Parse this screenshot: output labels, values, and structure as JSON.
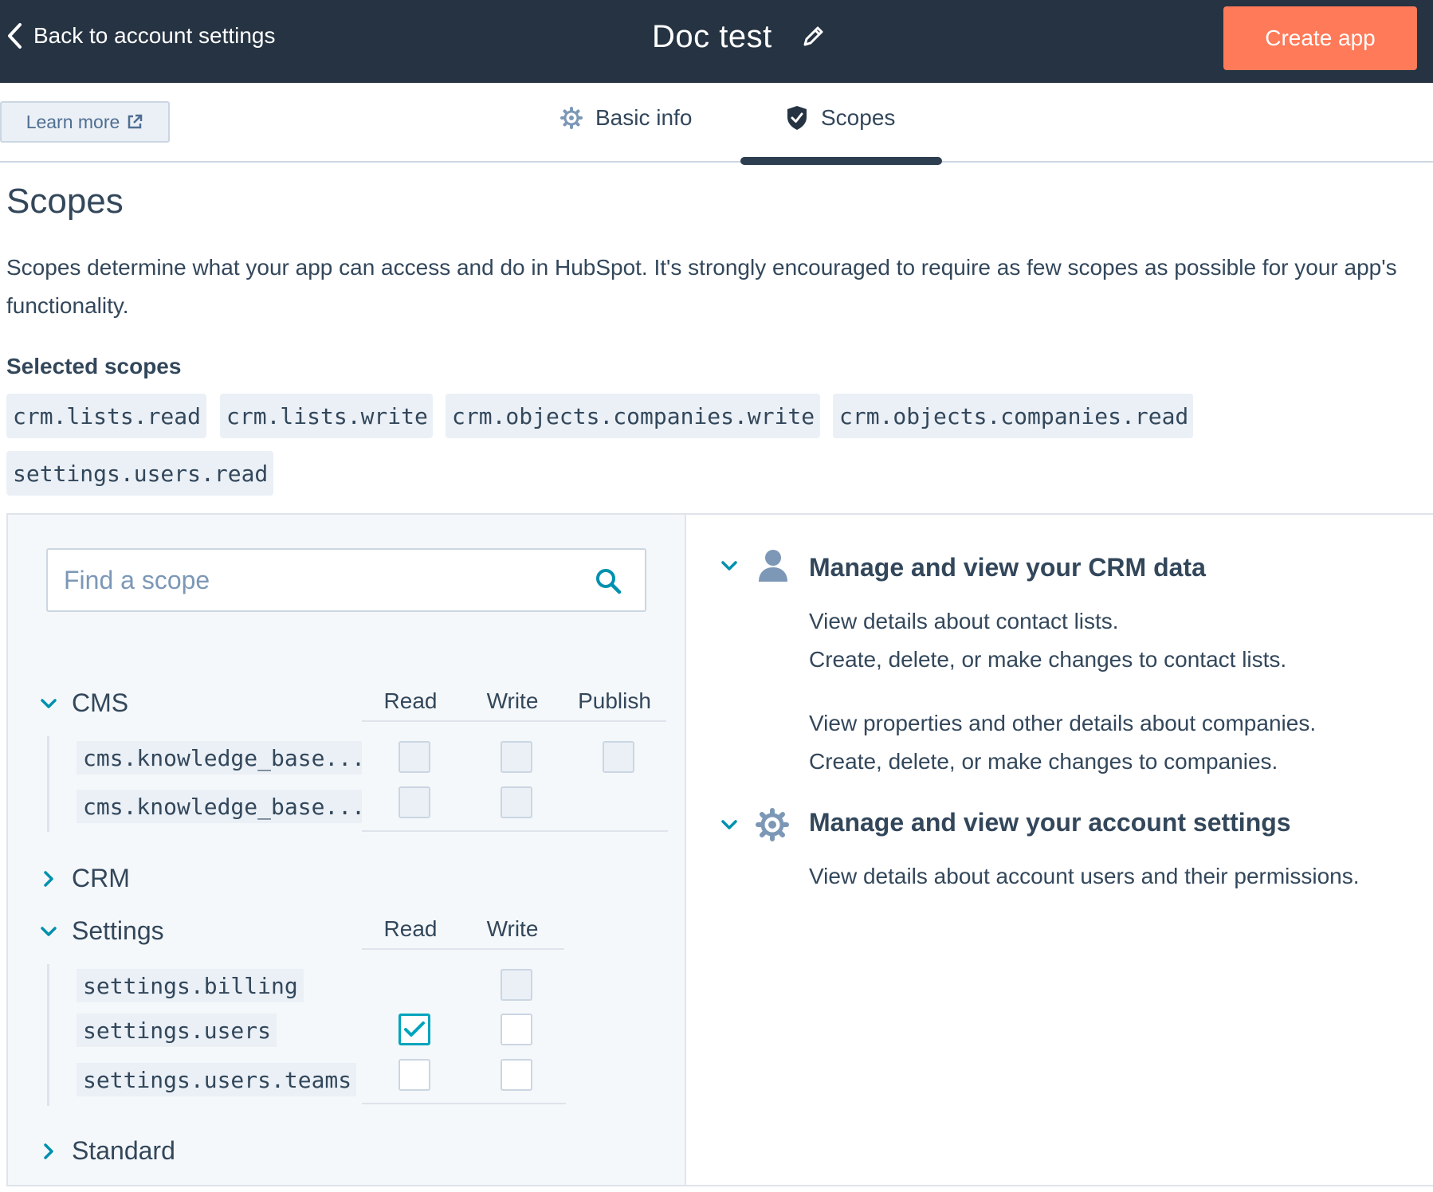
{
  "header": {
    "back_label": "Back to account settings",
    "app_title": "Doc test",
    "create_button": "Create app"
  },
  "toolbar": {
    "learn_more": "Learn more"
  },
  "tabs": [
    {
      "label": "Basic info",
      "icon": "gear-icon",
      "active": false
    },
    {
      "label": "Scopes",
      "icon": "shield-icon",
      "active": true
    }
  ],
  "page": {
    "heading": "Scopes",
    "description": "Scopes determine what your app can access and do in HubSpot. It's strongly encouraged to require as few scopes as possible for your app's functionality.",
    "selected_label": "Selected scopes",
    "selected_scopes": [
      "crm.lists.read",
      "crm.lists.write",
      "crm.objects.companies.write",
      "crm.objects.companies.read",
      "settings.users.read"
    ]
  },
  "search": {
    "placeholder": "Find a scope"
  },
  "scope_sections": {
    "cms": {
      "label": "CMS",
      "columns": [
        "Read",
        "Write",
        "Publish"
      ],
      "rows": [
        "cms.knowledge_base....",
        "cms.knowledge_base...."
      ]
    },
    "crm": {
      "label": "CRM"
    },
    "settings": {
      "label": "Settings",
      "columns": [
        "Read",
        "Write"
      ],
      "rows": [
        "settings.billing",
        "settings.users",
        "settings.users.teams"
      ]
    },
    "standard": {
      "label": "Standard"
    }
  },
  "permissions": {
    "crm": {
      "title": "Manage and view your CRM data",
      "lines": [
        "View details about contact lists.",
        "Create, delete, or make changes to contact lists.",
        "View properties and other details about companies.",
        "Create, delete, or make changes to companies."
      ]
    },
    "account": {
      "title": "Manage and view your account settings",
      "lines": [
        "View details about account users and their permissions."
      ]
    }
  },
  "colors": {
    "topbar": "#253342",
    "accent": "#ff7a59",
    "teal": "#00a4bd",
    "text": "#33475b"
  }
}
